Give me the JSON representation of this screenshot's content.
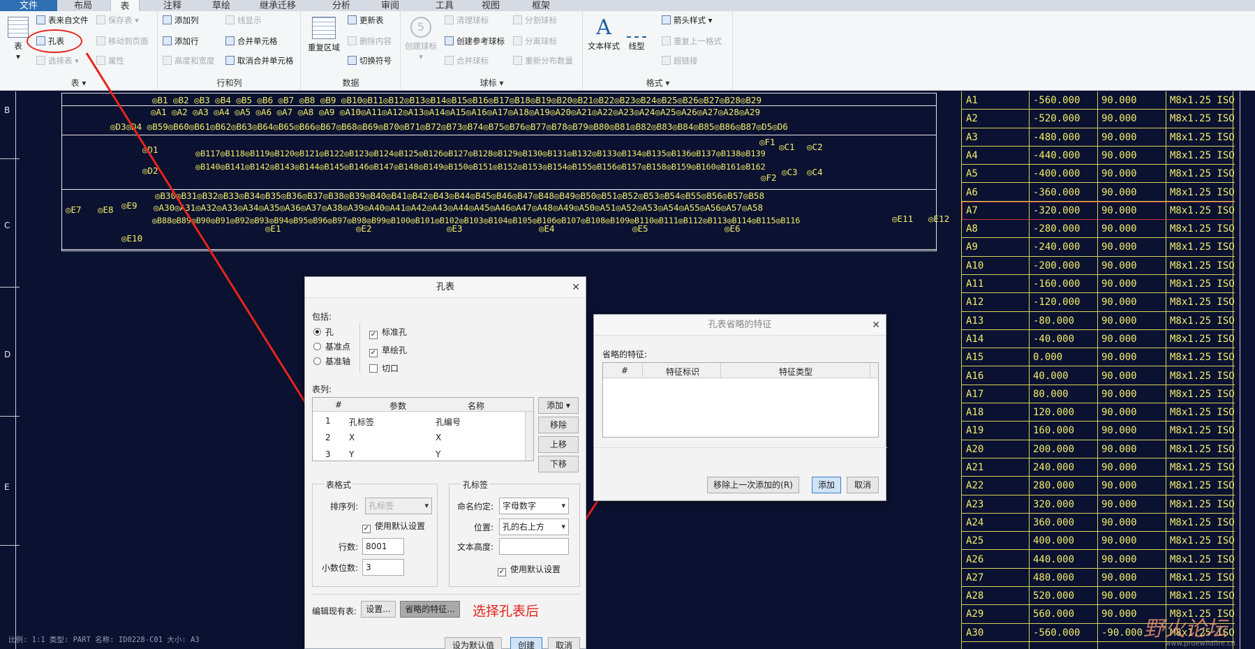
{
  "tabs": [
    "文件",
    "布局",
    "表",
    "注释",
    "草绘",
    "继承迁移",
    "分析",
    "审阅",
    "工具",
    "视图",
    "框架"
  ],
  "active_tab": "表",
  "ribbon": {
    "group_table": {
      "label": "表 ▾",
      "big": "表",
      "big_sub": "▾",
      "items": [
        "表来自文件",
        "孔表",
        "选择表 ▾",
        "保存表 ▾",
        "移动到页面",
        "属性"
      ]
    },
    "group_rows": {
      "label": "行和列",
      "items": [
        "添加列",
        "添加行",
        "高度和宽度",
        "线显示",
        "合并单元格",
        "取消合并单元格"
      ]
    },
    "group_data": {
      "label": "数据",
      "big": "重复区域",
      "items": [
        "更新表",
        "删除内容",
        "切换符号"
      ]
    },
    "group_balloon": {
      "label": "球标 ▾",
      "big": "创建球标",
      "big_sub": "▾",
      "items": [
        "清理球标",
        "创建参考球标",
        "合并球标",
        "分割球标",
        "分离球标",
        "重新分布数量"
      ]
    },
    "group_format": {
      "label": "格式 ▾",
      "big1": "文本样式",
      "big2": "线型",
      "items": [
        "箭头样式 ▾",
        "重复上一格式",
        "超链接"
      ]
    }
  },
  "canvas": {
    "zones": [
      "B",
      "C",
      "D",
      "E"
    ],
    "row_B1": "◎B1 ◎B2 ◎B3 ◎B4 ◎B5 ◎B6 ◎B7 ◎B8 ◎B9 ◎B10◎B11◎B12◎B13◎B14◎B15◎B16◎B17◎B18◎B19◎B20◎B21◎B22◎B23◎B24◎B25◎B26◎B27◎B28◎B29",
    "row_A1": "◎A1 ◎A2 ◎A3 ◎A4 ◎A5 ◎A6 ◎A7 ◎A8 ◎A9 ◎A10◎A11◎A12◎A13◎A14◎A15◎A16◎A17◎A18◎A19◎A20◎A21◎A22◎A23◎A24◎A25◎A26◎A27◎A28◎A29",
    "row_B59": "◎D3◎D4  ◎B59◎B60◎B61◎B62◎B63◎B64◎B65◎B66◎B67◎B68◎B69◎B70◎B71◎B72◎B73◎B74◎B75◎B76◎B77◎B78◎B79◎B80◎B81◎B82◎B83◎B84◎B85◎B86◎B87◎D5◎D6",
    "row_B117": "◎B117◎B118◎B119◎B120◎B121◎B122◎B123◎B124◎B125◎B126◎B127◎B128◎B129◎B130◎B131◎B132◎B133◎B134◎B135◎B136◎B137◎B138◎B139",
    "row_B140": "◎B140◎B141◎B142◎B143◎B144◎B145◎B146◎B147◎B148◎B149◎B150◎B151◎B152◎B153◎B154◎B155◎B156◎B157◎B158◎B159◎B160◎B161◎B162",
    "row_B30": "◎B30◎B31◎B32◎B33◎B34◎B35◎B36◎B37◎B38◎B39◎B40◎B41◎B42◎B43◎B44◎B45◎B46◎B47◎B48◎B49◎B50◎B51◎B52◎B53◎B54◎B55◎B56◎B57◎B58",
    "row_A30": "◎A30◎A31◎A32◎A33◎A34◎A35◎A36◎A37◎A38◎A39◎A40◎A41◎A42◎A43◎A44◎A45◎A46◎A47◎A48◎A49◎A50◎A51◎A52◎A53◎A54◎A55◎A56◎A57◎A58",
    "row_B88": "◎B88◎B89◎B90◎B91◎B92◎B93◎B94◎B95◎B96◎B97◎B98◎B99◎B100◎B101◎B102◎B103◎B104◎B105◎B106◎B107◎B108◎B109◎B110◎B111◎B112◎B113◎B114◎B115◎B116",
    "labels": {
      "d1": "◎D1",
      "d2": "◎D2",
      "f1": "◎F1",
      "c1": "◎C1",
      "c2": "◎C2",
      "f2": "◎F2",
      "c3": "◎C3",
      "c4": "◎C4",
      "e7": "◎E7",
      "e8": "◎E8",
      "e9": "◎E9",
      "e10": "◎E10",
      "e11": "◎E11",
      "e12": "◎E12",
      "e1": "◎E1",
      "e2": "◎E2",
      "e3": "◎E3",
      "e4": "◎E4",
      "e5": "◎E5",
      "e6": "◎E6"
    },
    "status": "比例: 1:1    类型: PART    名称: ID0228-C01    大小: A3"
  },
  "hole_table": {
    "rows": [
      [
        "A1",
        "-560.000",
        "90.000",
        "M8x1.25 ISO"
      ],
      [
        "A2",
        "-520.000",
        "90.000",
        "M8x1.25 ISO"
      ],
      [
        "A3",
        "-480.000",
        "90.000",
        "M8x1.25 ISO"
      ],
      [
        "A4",
        "-440.000",
        "90.000",
        "M8x1.25 ISO"
      ],
      [
        "A5",
        "-400.000",
        "90.000",
        "M8x1.25 ISO"
      ],
      [
        "A6",
        "-360.000",
        "90.000",
        "M8x1.25 ISO"
      ],
      [
        "A7",
        "-320.000",
        "90.000",
        "M8x1.25 ISO"
      ],
      [
        "A8",
        "-280.000",
        "90.000",
        "M8x1.25 ISO"
      ],
      [
        "A9",
        "-240.000",
        "90.000",
        "M8x1.25 ISO"
      ],
      [
        "A10",
        "-200.000",
        "90.000",
        "M8x1.25 ISO"
      ],
      [
        "A11",
        "-160.000",
        "90.000",
        "M8x1.25 ISO"
      ],
      [
        "A12",
        "-120.000",
        "90.000",
        "M8x1.25 ISO"
      ],
      [
        "A13",
        "-80.000",
        "90.000",
        "M8x1.25 ISO"
      ],
      [
        "A14",
        "-40.000",
        "90.000",
        "M8x1.25 ISO"
      ],
      [
        "A15",
        "0.000",
        "90.000",
        "M8x1.25 ISO"
      ],
      [
        "A16",
        "40.000",
        "90.000",
        "M8x1.25 ISO"
      ],
      [
        "A17",
        "80.000",
        "90.000",
        "M8x1.25 ISO"
      ],
      [
        "A18",
        "120.000",
        "90.000",
        "M8x1.25 ISO"
      ],
      [
        "A19",
        "160.000",
        "90.000",
        "M8x1.25 ISO"
      ],
      [
        "A20",
        "200.000",
        "90.000",
        "M8x1.25 ISO"
      ],
      [
        "A21",
        "240.000",
        "90.000",
        "M8x1.25 ISO"
      ],
      [
        "A22",
        "280.000",
        "90.000",
        "M8x1.25 ISO"
      ],
      [
        "A23",
        "320.000",
        "90.000",
        "M8x1.25 ISO"
      ],
      [
        "A24",
        "360.000",
        "90.000",
        "M8x1.25 ISO"
      ],
      [
        "A25",
        "400.000",
        "90.000",
        "M8x1.25 ISO"
      ],
      [
        "A26",
        "440.000",
        "90.000",
        "M8x1.25 ISO"
      ],
      [
        "A27",
        "480.000",
        "90.000",
        "M8x1.25 ISO"
      ],
      [
        "A28",
        "520.000",
        "90.000",
        "M8x1.25 ISO"
      ],
      [
        "A29",
        "560.000",
        "90.000",
        "M8x1.25 ISO"
      ],
      [
        "A30",
        "-560.000",
        "-90.000",
        "M8x1.25 ISO"
      ]
    ],
    "highlight_row": "A7"
  },
  "dlg_hole": {
    "title": "孔表",
    "include_label": "包括:",
    "radio": [
      "孔",
      "基准点",
      "基准轴"
    ],
    "checks": [
      "标准孔",
      "草绘孔",
      "切口"
    ],
    "columns_label": "表列:",
    "grid_head": [
      "#",
      "参数",
      "名称"
    ],
    "grid_rows": [
      [
        "1",
        "孔标签",
        "孔编号"
      ],
      [
        "2",
        "X",
        "X"
      ],
      [
        "3",
        "Y",
        "Y"
      ]
    ],
    "btn_add": "添加 ▾",
    "btn_remove": "移除",
    "btn_up": "上移",
    "btn_down": "下移",
    "fmt_title": "表格式",
    "sort_label": "排序列:",
    "sort_value": "孔标签",
    "use_default": "使用默认设置",
    "rows_label": "行数:",
    "rows_value": "8001",
    "dec_label": "小数位数:",
    "dec_value": "3",
    "tag_title": "孔标签",
    "naming_label": "命名约定:",
    "naming_value": "字母数字",
    "pos_label": "位置:",
    "pos_value": "孔的右上方",
    "text_h_label": "文本高度:",
    "use_default2": "使用默认设置",
    "edit_label": "编辑现有表:",
    "btn_settings": "设置...",
    "btn_omitted": "省略的特征...",
    "btn_set_default": "设为默认值",
    "btn_create": "创建",
    "btn_cancel": "取消",
    "annotation": "选择孔表后"
  },
  "dlg_omit": {
    "title": "孔表省略的特征",
    "label": "省略的特征:",
    "head": [
      "#",
      "特征标识",
      "特征类型"
    ],
    "btn_remove_last": "移除上一次添加的(R)",
    "btn_add": "添加",
    "btn_cancel": "取消"
  },
  "watermark": "野火论坛",
  "watermark_url": "www.proewildfire.cn"
}
